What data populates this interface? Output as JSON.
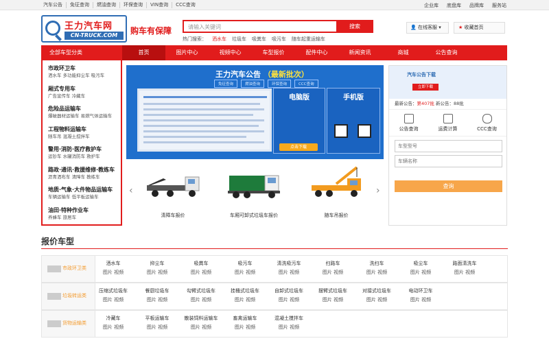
{
  "topbar": {
    "links": [
      "汽车公告",
      "免征查询",
      "燃油查询",
      "环保查询",
      "VIN查询",
      "CCC查询"
    ],
    "right_links": [
      "企业库",
      "底盘库",
      "品牌库",
      "服务站"
    ]
  },
  "logo": {
    "name": "王力汽车网",
    "domain": "CN-TRUCK.COM"
  },
  "slogan": "购车有保障",
  "search": {
    "placeholder": "请输入关键词",
    "button": "搜索"
  },
  "hot": {
    "label": "热门搜索：",
    "items": [
      "洒水车",
      "垃圾车",
      "吸粪车",
      "吸污车",
      "随车起重运输车"
    ]
  },
  "header_buttons": {
    "online": "在线客服",
    "favorite": "收藏首页"
  },
  "nav": {
    "category_title": "全部车型分类",
    "items": [
      "首页",
      "图片中心",
      "视频中心",
      "车型报价",
      "配件中心",
      "新闻资讯",
      "商城",
      "公告查询"
    ]
  },
  "categories": [
    {
      "title": "市政环卫车",
      "sub": "洒水车  多功能抑尘车  吸污车"
    },
    {
      "title": "厢式专用车",
      "sub": "广告宣传车  冷藏车"
    },
    {
      "title": "危险品运输车",
      "sub": "爆破器材运输车  易燃气体运输车"
    },
    {
      "title": "工程物料运输车",
      "sub": "随车吊  混凝土搅拌车"
    },
    {
      "title": "警用·消防·医疗救护车",
      "sub": "运钞车  水罐消防车  救护车"
    },
    {
      "title": "路政·通讯·救援维修·教练车",
      "sub": "沥青洒布车  清障车  教练车"
    },
    {
      "title": "地质·气象·大件物品运输车",
      "sub": "车辆运输车  低平板运输车"
    },
    {
      "title": "油田·特种作业车",
      "sub": "养蜂车  旅居车"
    }
  ],
  "banner": {
    "title_main": "王力汽车公告",
    "title_sub": "（最新批次）",
    "tags": [
      "免征查询",
      "燃油查询",
      "环保查询",
      "CCC查询"
    ],
    "pc_label": "电脑版",
    "mobile_label": "手机版",
    "download": "点击下载"
  },
  "trucks": [
    {
      "caption": "清障车报价"
    },
    {
      "caption": "车厢可卸式垃圾车报价"
    },
    {
      "caption": "随车吊报价"
    }
  ],
  "right_panel": {
    "image_title": "汽车公告下载",
    "image_button": "立即下载",
    "latest_prefix": "最新公告：",
    "latest_batch": "第407批",
    "latest_new": "新公告：88批",
    "tools": [
      {
        "label": "公告查询",
        "icon": "notice-icon"
      },
      {
        "label": "运费计算",
        "icon": "calculator-icon"
      },
      {
        "label": "CCC查询",
        "icon": "ccc-car-icon"
      }
    ],
    "field_model": "车型型号",
    "field_name": "车辆名称",
    "query_button": "查询"
  },
  "price_section": {
    "title": "报价车型",
    "rows": [
      {
        "label": "市政环卫类",
        "items": [
          "洒水车",
          "抑尘车",
          "吸粪车",
          "吸污车",
          "清洗吸污车",
          "扫路车",
          "洗扫车",
          "吸尘车",
          "路面清洗车"
        ]
      },
      {
        "label": "垃圾转运类",
        "items": [
          "压缩式垃圾车",
          "餐厨垃圾车",
          "勾臂式垃圾车",
          "挂桶式垃圾车",
          "自卸式垃圾车",
          "摆臂式垃圾车",
          "对接式垃圾车",
          "电动环卫车"
        ]
      },
      {
        "label": "货物运输类",
        "items": [
          "冷藏车",
          "平板运输车",
          "散装饲料运输车",
          "畜禽运输车",
          "混凝土搅拌车"
        ]
      }
    ],
    "sub_label": "图片  视频"
  },
  "colors": {
    "brand_red": "#e11c1c",
    "brand_blue": "#2f6db4",
    "orange": "#f7a64a"
  }
}
